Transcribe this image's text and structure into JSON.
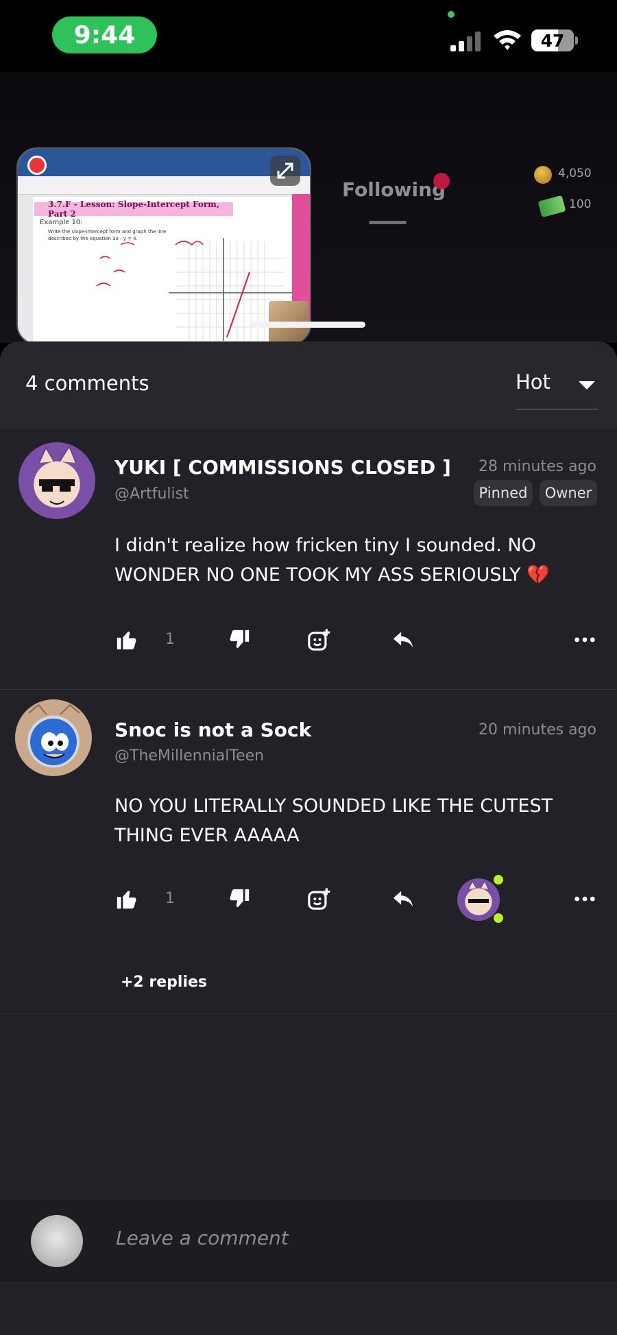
{
  "status_bar": {
    "time": "9:44",
    "battery": "47"
  },
  "header": {
    "tab_following": "Following",
    "coins": "4,050",
    "cash": "100"
  },
  "pip_video": {
    "lesson_title": "3.7.F - Lesson: Slope-Intercept Form, Part 2",
    "example": "Example 10:",
    "prompt": "Write the slope-intercept form and graph the line described by the equation 3x - y = 4."
  },
  "comments_panel": {
    "count_label": "4 comments",
    "sort_label": "Hot",
    "comments": [
      {
        "name": "YUKI [ COMMISSIONS CLOSED ]",
        "handle": "@Artfulist",
        "time": "28 minutes ago",
        "badges": [
          "Pinned",
          "Owner"
        ],
        "text": "I didn't realize how fricken tiny I sounded. NO WONDER NO ONE TOOK MY ASS SERIOUSLY 💔",
        "likes": "1"
      },
      {
        "name": "Snoc is not a Sock",
        "handle": "@TheMillennialTeen",
        "time": "20 minutes ago",
        "text": "NO YOU LITERALLY SOUNDED LIKE THE CUTEST THING EVER AAAAA",
        "likes": "1",
        "replies": "+2 replies"
      }
    ]
  },
  "composer": {
    "placeholder": "Leave a comment"
  },
  "colors": {
    "sheet_bg": "#232128",
    "time_pill": "#2fc25b",
    "accent_dot": "#c0183e"
  }
}
